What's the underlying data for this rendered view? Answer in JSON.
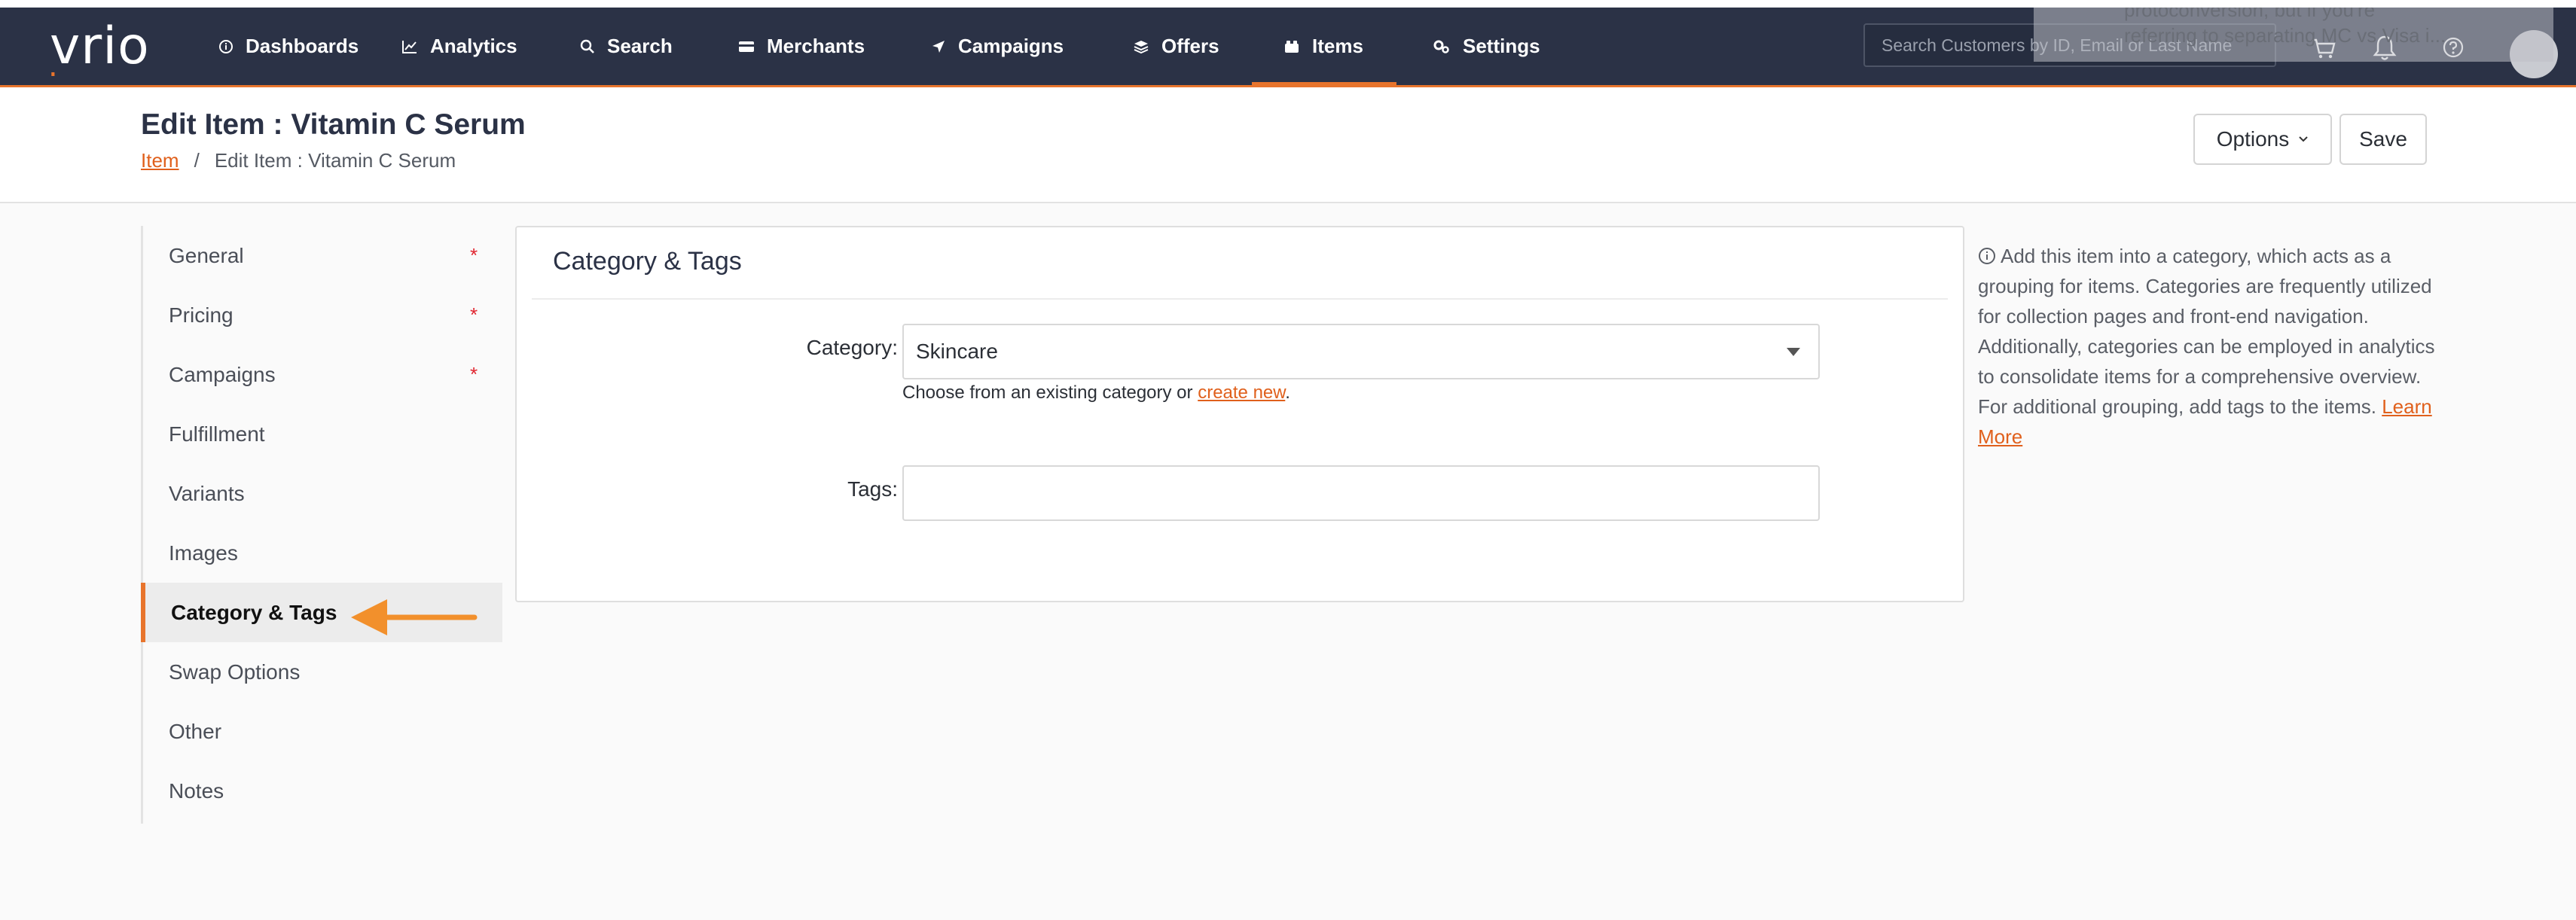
{
  "brand": {
    "logo_text": "vrio",
    "accent": "#e8742c",
    "nav_bg": "#2b3246"
  },
  "nav": {
    "items": [
      {
        "label": "Dashboards",
        "icon": "info-circle-icon"
      },
      {
        "label": "Analytics",
        "icon": "line-chart-icon"
      },
      {
        "label": "Search",
        "icon": "search-icon"
      },
      {
        "label": "Merchants",
        "icon": "credit-card-icon"
      },
      {
        "label": "Campaigns",
        "icon": "send-icon"
      },
      {
        "label": "Offers",
        "icon": "layers-icon"
      },
      {
        "label": "Items",
        "icon": "box-icon",
        "active": true
      },
      {
        "label": "Settings",
        "icon": "gears-icon"
      }
    ],
    "search_placeholder": "Search Customers by ID, Email or Last Name"
  },
  "toast": {
    "line1": "protoconversion, but if you're",
    "line2": "referring to separating MC vs Visa i..."
  },
  "header": {
    "title": "Edit Item : Vitamin C Serum",
    "breadcrumb": [
      {
        "label": "Item",
        "link": true
      },
      {
        "label": "/",
        "link": false
      },
      {
        "label": "Edit Item : Vitamin C Serum",
        "link": false
      }
    ],
    "options_label": "Options",
    "save_label": "Save"
  },
  "side_menu": {
    "items": [
      {
        "label": "General",
        "required": true
      },
      {
        "label": "Pricing",
        "required": true
      },
      {
        "label": "Campaigns",
        "required": true
      },
      {
        "label": "Fulfillment",
        "required": false
      },
      {
        "label": "Variants",
        "required": false
      },
      {
        "label": "Images",
        "required": false
      },
      {
        "label": "Category & Tags",
        "required": false,
        "active": true
      },
      {
        "label": "Swap Options",
        "required": false
      },
      {
        "label": "Other",
        "required": false
      },
      {
        "label": "Notes",
        "required": false
      }
    ],
    "required_mark": "*"
  },
  "panel": {
    "title": "Category & Tags",
    "category_label": "Category:",
    "category_value": "Skincare",
    "hint_prefix": "Choose from an existing category or ",
    "hint_link": "create new",
    "hint_suffix": ".",
    "tags_label": "Tags:",
    "tags_value": ""
  },
  "help": {
    "text": "Add this item into a category, which acts as a grouping for items. Categories are frequently utilized for collection pages and front-end navigation. Additionally, categories can be employed in analytics to consolidate items for a comprehensive overview. For additional grouping, add tags to the items. ",
    "link": "Learn More"
  }
}
